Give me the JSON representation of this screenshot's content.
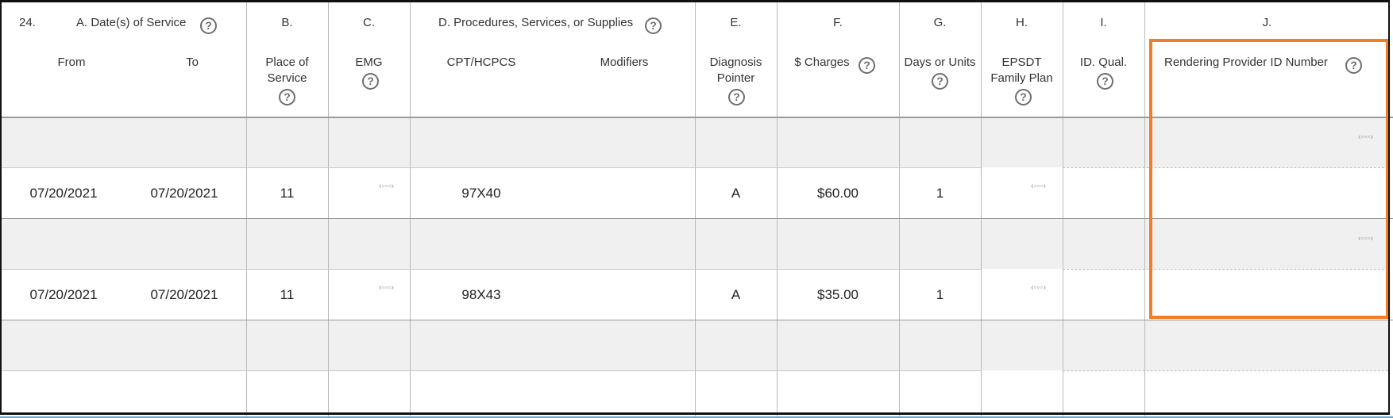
{
  "header": {
    "row_number": "24.",
    "date_label": "A. Date(s) of Service",
    "from_label": "From",
    "to_label": "To",
    "b_letter": "B.",
    "place_line1": "Place of",
    "place_line2": "Service",
    "c_letter": "C.",
    "emg_label": "EMG",
    "procedures_label": "D. Procedures, Services, or Supplies",
    "cpt_label": "CPT/HCPCS",
    "modifiers_label": "Modifiers",
    "e_letter": "E.",
    "diag_line1": "Diagnosis",
    "diag_line2": "Pointer",
    "f_letter": "F.",
    "charges_label": "$ Charges",
    "g_letter": "G.",
    "days_label": "Days or Units",
    "h_letter": "H.",
    "epsdt_line1": "EPSDT",
    "epsdt_line2": "Family Plan",
    "i_letter": "I.",
    "idqual_label": "ID. Qual.",
    "j_letter": "J.",
    "rendering_label": "Rendering Provider ID Number"
  },
  "help_icon": "?",
  "ellipsis_icon": "‹◦◦◦›",
  "service_lines": [
    {
      "from": "07/20/2021",
      "to": "07/20/2021",
      "place_of_service": "11",
      "emg": "",
      "cpt": "97X40",
      "modifiers": "",
      "diagnosis_pointer": "A",
      "charges": "$60.00",
      "days_units": "1",
      "epsdt": "",
      "id_qual": "",
      "rendering_provider_id": ""
    },
    {
      "from": "07/20/2021",
      "to": "07/20/2021",
      "place_of_service": "11",
      "emg": "",
      "cpt": "98X43",
      "modifiers": "",
      "diagnosis_pointer": "A",
      "charges": "$35.00",
      "days_units": "1",
      "epsdt": "",
      "id_qual": "",
      "rendering_provider_id": ""
    }
  ],
  "colors": {
    "highlight": "#f07d28",
    "shaded_row": "#f0f0f0",
    "help_icon": "#6e6e6e"
  }
}
